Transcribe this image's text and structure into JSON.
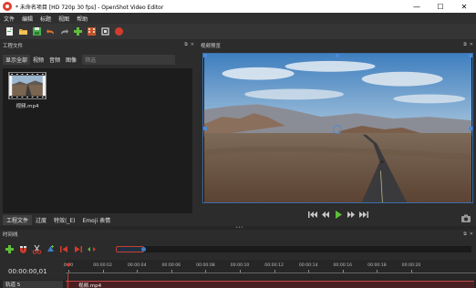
{
  "window": {
    "title": "* 未命名项目 [HD 720p 30 fps] - OpenShot Video Editor",
    "minimize": "—",
    "maximize": "☐",
    "close": "✕"
  },
  "menubar": {
    "items": [
      "文件",
      "编辑",
      "标题",
      "视图",
      "帮助"
    ]
  },
  "toolbar": {
    "icons": [
      "new-project-icon",
      "open-project-icon",
      "save-project-icon",
      "undo-icon",
      "redo-icon",
      "import-files-icon",
      "choose-profile-icon",
      "fullscreen-icon",
      "export-video-icon"
    ]
  },
  "files_panel": {
    "title": "工程文件",
    "filters": [
      "显示全部",
      "视频",
      "音频",
      "图像"
    ],
    "active_filter": "显示全部",
    "filter_placeholder": "筛选",
    "files": [
      {
        "name": "视频.mp4"
      }
    ]
  },
  "preview_panel": {
    "title": "视频预览"
  },
  "bottom_tabs": {
    "tabs": [
      "工程文件",
      "过度",
      "特效(_E)",
      "Emoji 表情"
    ],
    "active": "工程文件"
  },
  "timeline": {
    "title": "时间线",
    "timecode": "00:00:00,01",
    "ticks": [
      "0:00",
      "00:00:02",
      "00:00:04",
      "00:00:06",
      "00:00:08",
      "00:00:10",
      "00:00:12",
      "00:00:14",
      "00:00:16",
      "00:00:18",
      "00:00:20"
    ],
    "tracks": [
      {
        "name": "轨道 5",
        "clip": "视频.mp4"
      }
    ],
    "zoom_start": 0.0,
    "zoom_end": 0.08
  },
  "colors": {
    "accent_blue": "#3c6ea8",
    "record_red": "#d23c2c",
    "play_green": "#5fbf3a",
    "clip_fill": "#4a1f22"
  }
}
